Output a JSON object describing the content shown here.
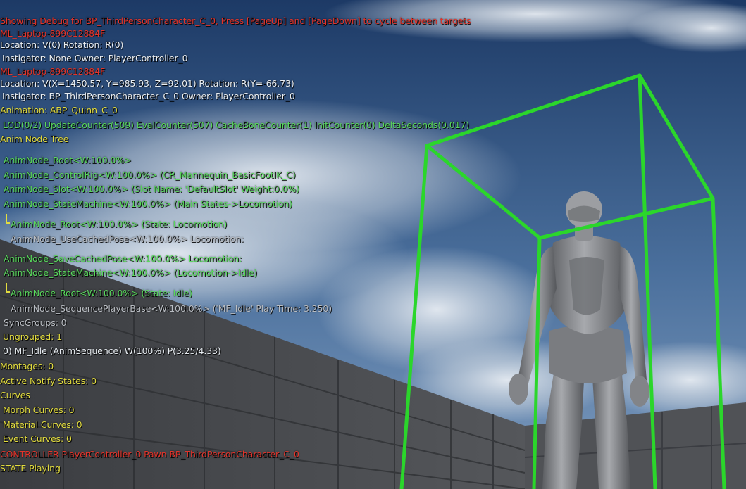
{
  "debug": {
    "lines": [
      {
        "id": "showing-debug",
        "text": "Showing Debug for BP_ThirdPersonCharacter_C_0, Press [PageUp] and [PageDown] to cycle between targets",
        "color": "#e2342b"
      },
      {
        "id": "machine-name-1",
        "text": "ML_Laptop-899C12884F",
        "color": "#e2342b"
      },
      {
        "id": "location-1",
        "text": "Location: V(0) Rotation: R(0)",
        "color": "#e9eef3"
      },
      {
        "id": "instigator-1",
        "text": "Instigator: None Owner: PlayerController_0",
        "color": "#e9eef3"
      },
      {
        "id": "machine-name-2",
        "text": "ML_Laptop-899C12884F",
        "color": "#e2342b"
      },
      {
        "id": "location-2",
        "text": "Location: V(X=1450.57, Y=985.93, Z=92.01) Rotation: R(Y=-66.73)",
        "color": "#e9eef3"
      },
      {
        "id": "instigator-2",
        "text": "Instigator: BP_ThirdPersonCharacter_C_0 Owner: PlayerController_0",
        "color": "#e9eef3"
      },
      {
        "id": "animation-header",
        "text": "Animation: ABP_Quinn_C_0",
        "color": "#e2dc3f"
      },
      {
        "id": "lod-counters",
        "text": "LOD(0/2) UpdateCounter(509) EvalCounter(507) CacheBoneCounter(1) InitCounter(0) DeltaSeconds(0.017)",
        "color": "#59d85d"
      },
      {
        "id": "anim-node-tree-header",
        "text": "Anim Node Tree",
        "color": "#e2dc3f"
      },
      {
        "id": "node-root",
        "text": "AnimNode_Root<W:100.0%>",
        "color": "#59d85d"
      },
      {
        "id": "node-controlrig",
        "text": "AnimNode_ControlRig<W:100.0%> (CR_Mannequin_BasicFootIK_C)",
        "color": "#59d85d"
      },
      {
        "id": "node-slot",
        "text": "AnimNode_Slot<W:100.0%> (Slot Name: 'DefaultSlot' Weight:0.0%)",
        "color": "#59d85d"
      },
      {
        "id": "node-statemachine-main",
        "text": "AnimNode_StateMachine<W:100.0%> (Main States->Locomotion)",
        "color": "#59d85d"
      },
      {
        "id": "node-root-locomotion",
        "text": "AnimNode_Root<W:100.0%> (State: Locomotion)",
        "color": "#59d85d"
      },
      {
        "id": "node-usecachedpose",
        "text": "AnimNode_UseCachedPose<W:100.0%> Locomotion:",
        "color": "#b9bdc3"
      },
      {
        "id": "node-savecachedpose",
        "text": "AnimNode_SaveCachedPose<W:100.0%> Locomotion:",
        "color": "#59d85d"
      },
      {
        "id": "node-statemachine-loco",
        "text": "AnimNode_StateMachine<W:100.0%> (Locomotion->Idle)",
        "color": "#59d85d"
      },
      {
        "id": "node-root-idle",
        "text": "AnimNode_Root<W:100.0%> (State: Idle)",
        "color": "#59d85d"
      },
      {
        "id": "node-sequenceplayer",
        "text": "AnimNode_SequencePlayerBase<W:100.0%> ('MF_Idle' Play Time: 3.250)",
        "color": "#b9bdc3"
      },
      {
        "id": "syncgroups",
        "text": "SyncGroups: 0",
        "color": "#b9bdc3"
      },
      {
        "id": "ungrouped",
        "text": "Ungrouped: 1",
        "color": "#e2dc3f"
      },
      {
        "id": "mf-idle-sequence",
        "text": "0) MF_Idle (AnimSequence) W(100%) P(3.25/4.33)",
        "color": "#e9eef3"
      },
      {
        "id": "montages",
        "text": "Montages: 0",
        "color": "#e2dc3f"
      },
      {
        "id": "active-notify-states",
        "text": "Active Notify States: 0",
        "color": "#e2dc3f"
      },
      {
        "id": "curves-header",
        "text": "Curves",
        "color": "#e2dc3f"
      },
      {
        "id": "morph-curves",
        "text": "Morph Curves: 0",
        "color": "#e2dc3f"
      },
      {
        "id": "material-curves",
        "text": "Material Curves: 0",
        "color": "#e2dc3f"
      },
      {
        "id": "event-curves",
        "text": "Event Curves: 0",
        "color": "#e2dc3f"
      },
      {
        "id": "controller-line",
        "text": "CONTROLLER PlayerController_0 Pawn BP_ThirdPersonCharacter_C_0",
        "color": "#e2342b"
      },
      {
        "id": "state-playing",
        "text": "STATE Playing",
        "color": "#e2dc3f"
      }
    ]
  },
  "scene": {
    "sky_top_color": "#1f3f6d",
    "sky_bottom_color": "#6b8db5",
    "wall_color": "#4a4c50",
    "floor_color": "#3f4144",
    "bounding_box_color": "#2bd62b",
    "character_color": "#8d8f93"
  }
}
